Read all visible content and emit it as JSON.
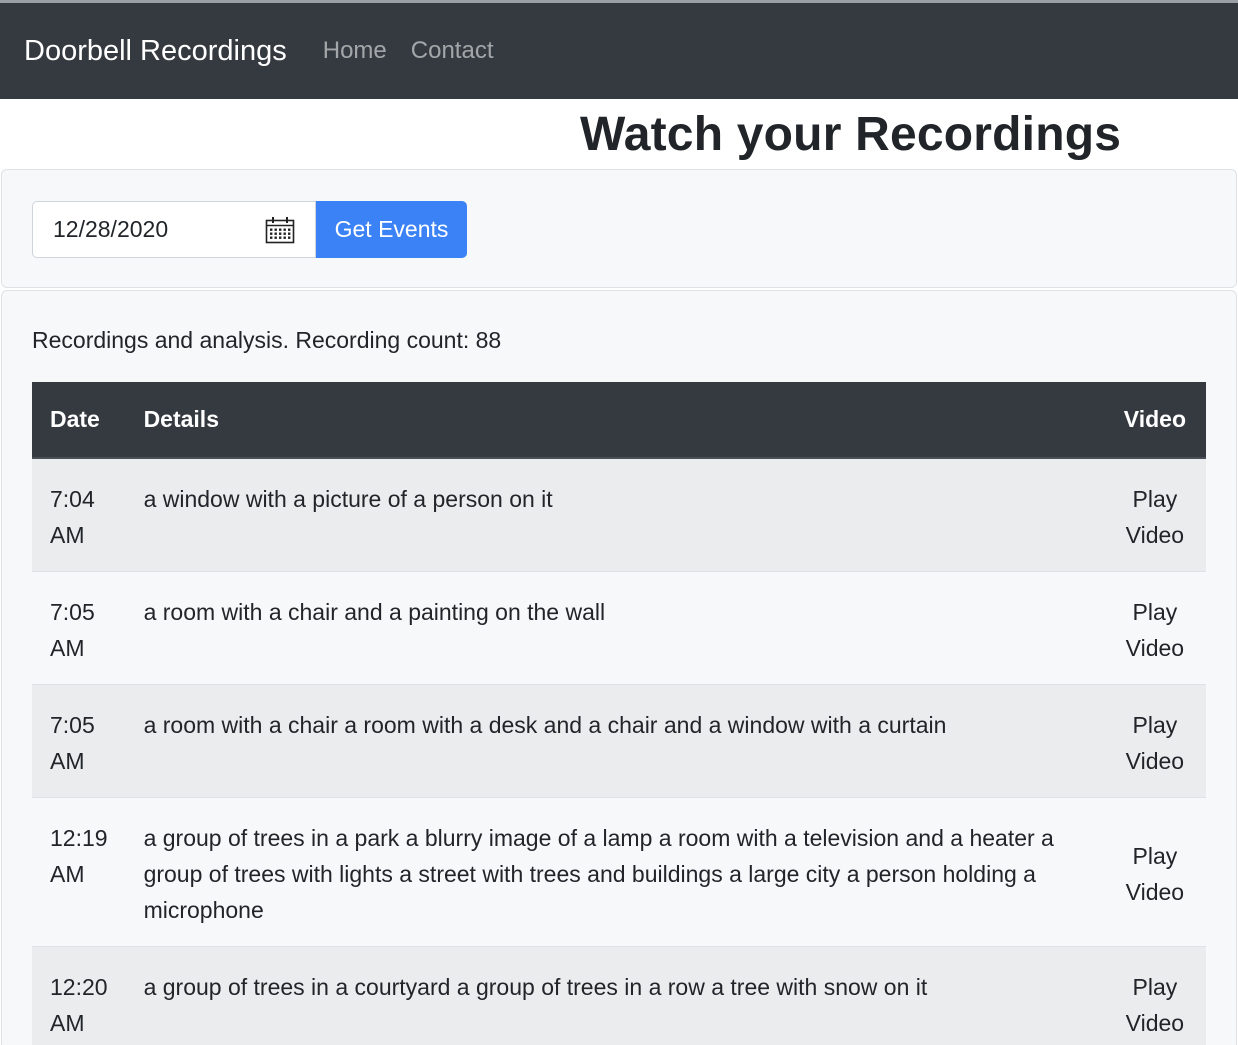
{
  "navbar": {
    "brand": "Doorbell Recordings",
    "links": [
      "Home",
      "Contact"
    ]
  },
  "page_title": "Watch your Recordings",
  "filter": {
    "date_value": "12/28/2020",
    "button_label": "Get Events"
  },
  "results": {
    "count_text": "Recordings and analysis. Recording count: 88",
    "columns": [
      "Date",
      "Details",
      "Video"
    ],
    "rows": [
      {
        "time": "7:04 AM",
        "details": "a window with a picture of a person on it",
        "video": "Play Video"
      },
      {
        "time": "7:05 AM",
        "details": "a room with a chair and a painting on the wall",
        "video": "Play Video"
      },
      {
        "time": "7:05 AM",
        "details": "a room with a chair a room with a desk and a chair and a window with a curtain",
        "video": "Play Video"
      },
      {
        "time": "12:19 AM",
        "details": "a group of trees in a park a blurry image of a lamp a room with a television and a heater a group of trees with lights a street with trees and buildings a large city a person holding a microphone",
        "video": "Play Video"
      },
      {
        "time": "12:20 AM",
        "details": "a group of trees in a courtyard a group of trees in a row a tree with snow on it",
        "video": "Play Video"
      }
    ]
  },
  "colors": {
    "navbar": "#343a40",
    "button": "#3b82f6",
    "card": "#f7f8f9"
  }
}
